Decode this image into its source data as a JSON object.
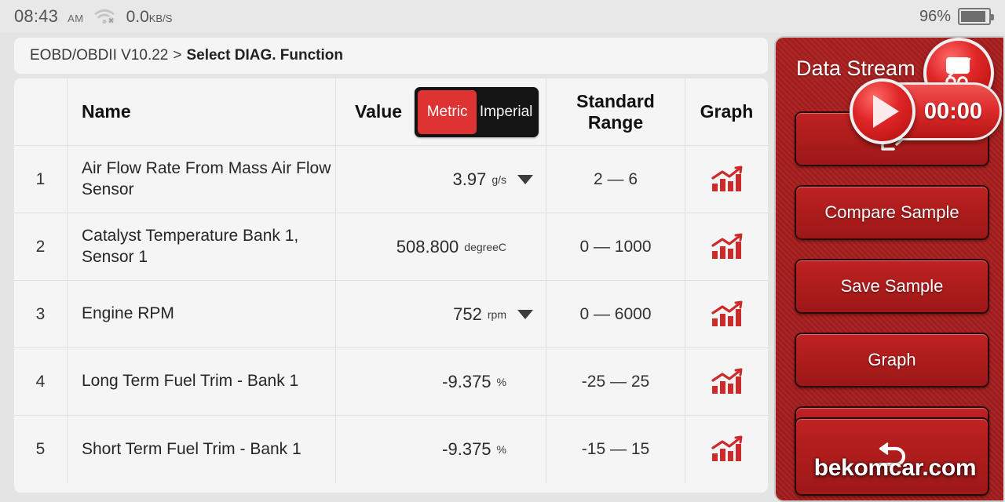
{
  "statusbar": {
    "time": "08:43",
    "ampm": "AM",
    "wifi_icon": "wifi-off-icon",
    "network_speed": "0.0",
    "network_speed_unit": "KB/S",
    "battery_percent": "96%",
    "battery_icon": "battery-icon"
  },
  "breadcrumb": {
    "root": "EOBD/OBDII V10.22",
    "separator": ">",
    "current": "Select DIAG. Function"
  },
  "table": {
    "headers": {
      "index": "",
      "name": "Name",
      "value": "Value",
      "standard_range": "Standard Range",
      "graph": "Graph"
    },
    "unit_toggle": {
      "metric_label": "Metric",
      "imperial_label": "Imperial",
      "selected": "Metric",
      "selected_color": "#dd3333",
      "background_color": "#141414"
    },
    "rows": [
      {
        "index": "1",
        "name": "Air Flow Rate From Mass Air Flow Sensor",
        "value": "3.97",
        "unit": "g/s",
        "has_dropdown": true,
        "range": "2 — 6",
        "graph_icon": "bar-chart-trend-icon"
      },
      {
        "index": "2",
        "name": "Catalyst Temperature Bank 1, Sensor 1",
        "value": "508.800",
        "unit": "degreeC",
        "has_dropdown": false,
        "range": "0 — 1000",
        "graph_icon": "bar-chart-trend-icon"
      },
      {
        "index": "3",
        "name": "Engine RPM",
        "value": "752",
        "unit": "rpm",
        "has_dropdown": true,
        "range": "0 — 6000",
        "graph_icon": "bar-chart-trend-icon"
      },
      {
        "index": "4",
        "name": "Long Term Fuel Trim - Bank 1",
        "value": "-9.375",
        "unit": "%",
        "has_dropdown": false,
        "range": "-25 — 25",
        "graph_icon": "bar-chart-trend-icon"
      },
      {
        "index": "5",
        "name": "Short Term Fuel Trim - Bank 1",
        "value": "-9.375",
        "unit": "%",
        "has_dropdown": false,
        "range": "-15 — 15",
        "graph_icon": "bar-chart-trend-icon"
      }
    ]
  },
  "panel": {
    "title": "Data Stream",
    "accent_color": "#a51d1d",
    "buttons": [
      {
        "label": "",
        "icon": "exit-arrow-icon"
      },
      {
        "label": "Compare Sample",
        "icon": ""
      },
      {
        "label": "Save Sample",
        "icon": ""
      },
      {
        "label": "Graph",
        "icon": ""
      },
      {
        "label": "",
        "icon": ""
      },
      {
        "label": "",
        "icon": "back-arrow-icon"
      }
    ]
  },
  "overlay": {
    "record_timer": "00:00",
    "play_icon": "play-icon",
    "snip_icon": "screenshot-snip-icon"
  },
  "watermark": "bekomcar.com"
}
